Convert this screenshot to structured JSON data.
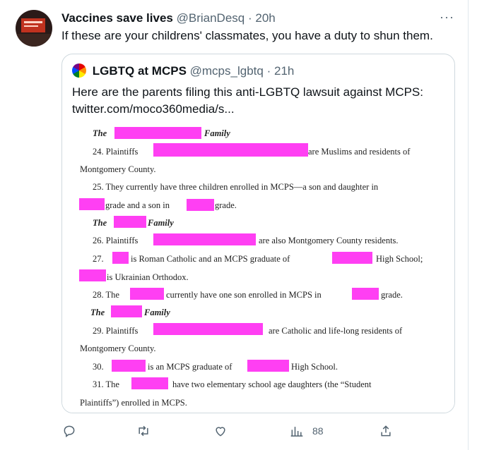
{
  "tweet": {
    "name": "Vaccines save lives",
    "handle": "@BrianDesq",
    "separator": "·",
    "time": "20h",
    "text": "If these are your childrens' classmates, you have a duty to shun them.",
    "more": "···"
  },
  "quote": {
    "name": "LGBTQ at MCPS",
    "handle": "@mcps_lgbtq",
    "separator": "·",
    "time": "21h",
    "text_line1": "Here are the parents filing this anti-LGBTQ lawsuit against MCPS:",
    "text_line2": "twitter.com/moco360media/s..."
  },
  "document": {
    "l1_a": "The",
    "l1_b": "Family",
    "l2_a": "24.  Plaintiffs",
    "l2_b": "are Muslims and residents of",
    "l3": "Montgomery County.",
    "l4": "25.  They currently have three children enrolled in MCPS—a son and daughter in",
    "l5_a": "grade and a son in",
    "l5_b": "grade.",
    "l6_a": "The",
    "l6_b": "Family",
    "l7_a": "26.  Plaintiffs",
    "l7_b": "are also Montgomery County residents.",
    "l8_a": "27.",
    "l8_b": "is Roman Catholic and an MCPS graduate of",
    "l8_c": "High School;",
    "l9": "is Ukrainian Orthodox.",
    "l10_a": "28.  The",
    "l10_b": "currently have one son enrolled in MCPS in",
    "l10_c": "grade.",
    "l11_a": "The",
    "l11_b": "Family",
    "l12_a": "29.  Plaintiffs",
    "l12_b": "are Catholic and life-long residents of",
    "l13": "Montgomery County.",
    "l14_a": "30.",
    "l14_b": "is an MCPS graduate of",
    "l14_c": "High School.",
    "l15_a": "31.  The",
    "l15_b": "have two elementary school age daughters (the “Student",
    "l16": "Plaintiffs”) enrolled in MCPS."
  },
  "actions": {
    "views_count": "88",
    "icons": [
      "reply-icon",
      "retweet-icon",
      "like-icon",
      "views-icon",
      "share-icon"
    ]
  },
  "colors": {
    "redaction": "#ff3ff3",
    "muted": "#536471",
    "border": "#cfd9de"
  }
}
